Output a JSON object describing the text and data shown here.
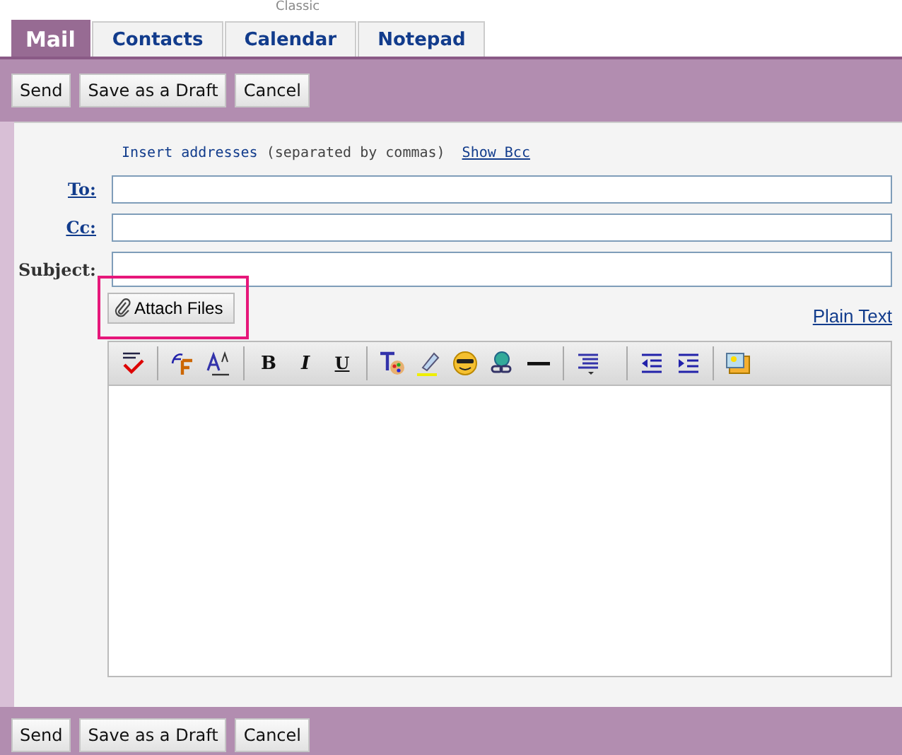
{
  "header": {
    "caption": "Classic"
  },
  "tabs": [
    {
      "label": "Mail",
      "selected": true
    },
    {
      "label": "Contacts",
      "selected": false
    },
    {
      "label": "Calendar",
      "selected": false
    },
    {
      "label": "Notepad",
      "selected": false
    }
  ],
  "top_actions": [
    "Send",
    "Save as a Draft",
    "Cancel"
  ],
  "compose": {
    "hint": "Insert addresses",
    "hint_note": "(separated by commas)",
    "show_bcc": "Show Bcc",
    "fields": [
      {
        "label": "To:",
        "kind": "link"
      },
      {
        "label": "Cc:",
        "kind": "link"
      },
      {
        "label": "Subject:",
        "kind": "plain"
      }
    ],
    "attach": "Attach Files",
    "attach_highlighted": true,
    "plain_text": "Plain Text",
    "format": {
      "bold": "B",
      "italic": "I",
      "underline": "U"
    }
  },
  "bottom_actions": [
    "Send",
    "Save as a Draft",
    "Cancel"
  ]
}
